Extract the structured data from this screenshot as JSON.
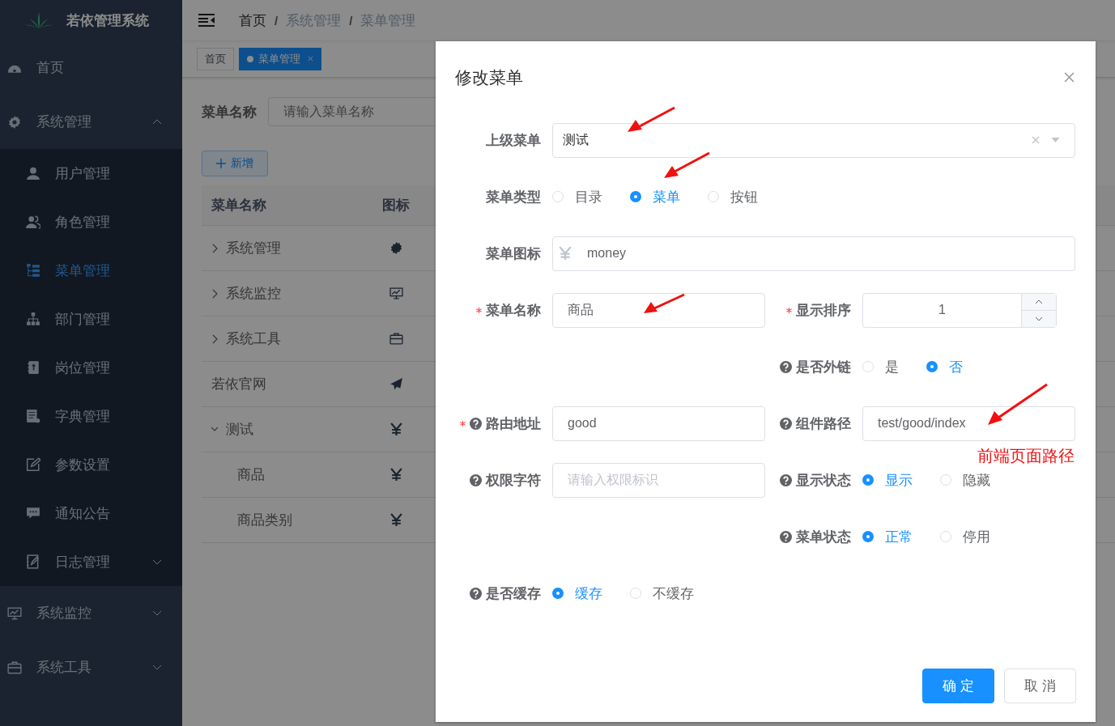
{
  "sidebar": {
    "title": "若依管理系统",
    "items": [
      {
        "label": "首页",
        "selected": false
      },
      {
        "label": "系统管理",
        "selected": false,
        "expanded": true,
        "children": [
          {
            "label": "用户管理",
            "selected": false
          },
          {
            "label": "角色管理",
            "selected": false
          },
          {
            "label": "菜单管理",
            "selected": true
          },
          {
            "label": "部门管理",
            "selected": false
          },
          {
            "label": "岗位管理",
            "selected": false
          },
          {
            "label": "字典管理",
            "selected": false
          },
          {
            "label": "参数设置",
            "selected": false
          },
          {
            "label": "通知公告",
            "selected": false
          },
          {
            "label": "日志管理",
            "selected": false,
            "expanded": false
          }
        ]
      },
      {
        "label": "系统监控",
        "selected": false,
        "expanded": false
      },
      {
        "label": "系统工具",
        "selected": false,
        "expanded": false
      }
    ]
  },
  "breadcrumb": {
    "separator": "/",
    "items": [
      "首页",
      "系统管理",
      "菜单管理"
    ]
  },
  "tags": [
    {
      "label": "首页",
      "selected": false
    },
    {
      "label": "菜单管理",
      "selected": true
    }
  ],
  "search": {
    "label": "菜单名称",
    "placeholder": "请输入菜单名称"
  },
  "add_button": "新增",
  "table": {
    "columns": [
      "菜单名称",
      "图标"
    ],
    "rows": [
      {
        "name": "系统管理",
        "expanded": false
      },
      {
        "name": "系统监控",
        "expanded": false
      },
      {
        "name": "系统工具",
        "expanded": false
      },
      {
        "name": "若依官网"
      },
      {
        "name": "测试",
        "expanded": true,
        "children": [
          {
            "name": "商品"
          },
          {
            "name": "商品类别"
          }
        ]
      }
    ]
  },
  "dialog": {
    "title": "修改菜单",
    "rows": [
      {
        "full": {
          "label": "上级菜单",
          "required": false,
          "help": false,
          "kind": "select",
          "value": "测试"
        }
      },
      {
        "full": {
          "label": "菜单类型",
          "required": false,
          "help": false,
          "kind": "radio",
          "options": [
            {
              "label": "目录",
              "selected": false
            },
            {
              "label": "菜单",
              "selected": true
            },
            {
              "label": "按钮",
              "selected": false
            }
          ]
        }
      },
      {
        "full": {
          "label": "菜单图标",
          "required": false,
          "help": false,
          "kind": "icon-input",
          "value": "money"
        }
      },
      {
        "left": {
          "label": "菜单名称",
          "required": true,
          "help": false,
          "kind": "input",
          "value": "商品"
        },
        "right": {
          "label": "显示排序",
          "required": true,
          "help": false,
          "kind": "number",
          "value": "1"
        }
      },
      {
        "right": {
          "label": "是否外链",
          "required": false,
          "help": true,
          "kind": "radio",
          "options": [
            {
              "label": "是",
              "selected": false
            },
            {
              "label": "否",
              "selected": true
            }
          ]
        }
      },
      {
        "left": {
          "label": "路由地址",
          "required": true,
          "help": true,
          "kind": "input",
          "value": "good"
        },
        "right": {
          "label": "组件路径",
          "required": false,
          "help": true,
          "kind": "input",
          "value": "test/good/index"
        }
      },
      {
        "left": {
          "label": "权限字符",
          "required": false,
          "help": true,
          "kind": "input",
          "placeholder": "请输入权限标识"
        },
        "right": {
          "label": "显示状态",
          "required": false,
          "help": true,
          "kind": "radio",
          "options": [
            {
              "label": "显示",
              "selected": true
            },
            {
              "label": "隐藏",
              "selected": false
            }
          ]
        }
      },
      {
        "right": {
          "label": "菜单状态",
          "required": false,
          "help": true,
          "kind": "radio",
          "options": [
            {
              "label": "正常",
              "selected": true
            },
            {
              "label": "停用",
              "selected": false
            }
          ]
        }
      },
      {
        "left": {
          "label": "是否缓存",
          "required": false,
          "help": true,
          "kind": "radio",
          "options": [
            {
              "label": "缓存",
              "selected": true
            },
            {
              "label": "不缓存",
              "selected": false
            }
          ]
        }
      }
    ],
    "buttons": [
      {
        "label": "确 定",
        "kind": "primary"
      },
      {
        "label": "取 消",
        "kind": "default"
      }
    ]
  },
  "annotation": {
    "note": "前端页面路径"
  }
}
